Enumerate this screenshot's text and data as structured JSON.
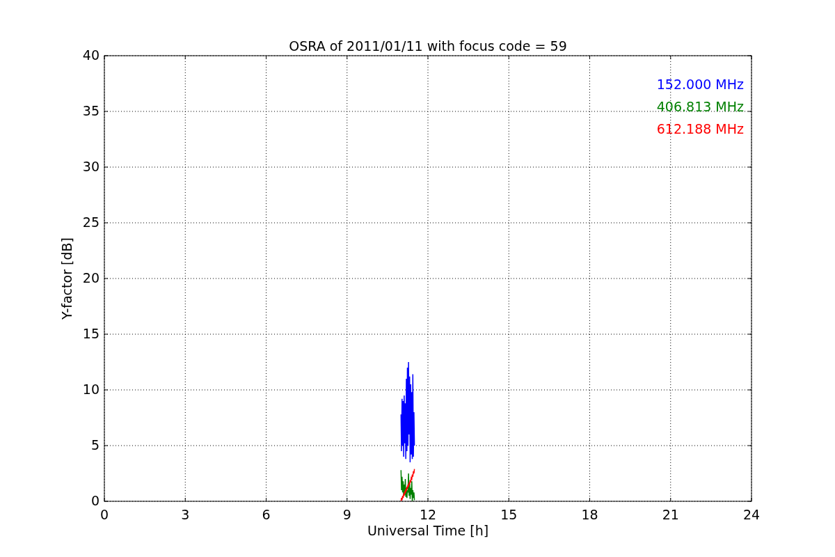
{
  "chart": {
    "chart_data": {
      "type": "line",
      "title": "OSRA of 2011/01/11 with focus code = 59",
      "xlabel": "Universal Time [h]",
      "ylabel": "Y-factor [dB]",
      "x": [
        11.0,
        11.02,
        11.04,
        11.06,
        11.08,
        11.1,
        11.12,
        11.14,
        11.16,
        11.18,
        11.2,
        11.22,
        11.24,
        11.26,
        11.28,
        11.3,
        11.32,
        11.34,
        11.36,
        11.38,
        11.4,
        11.42,
        11.44,
        11.46,
        11.48,
        11.5
      ],
      "series": [
        {
          "name": "152.000 MHz",
          "color": "#0000ff",
          "values": [
            7.8,
            4.5,
            9.2,
            5.0,
            9.0,
            4.0,
            9.5,
            5.2,
            8.8,
            3.8,
            11.0,
            4.5,
            12.0,
            5.0,
            12.5,
            6.0,
            11.2,
            3.5,
            10.5,
            4.2,
            9.8,
            3.8,
            11.4,
            4.0,
            8.0,
            5.0
          ]
        },
        {
          "name": "406.813 MHz",
          "color": "#008000",
          "values": [
            2.8,
            1.0,
            2.2,
            0.8,
            1.8,
            0.5,
            1.5,
            0.6,
            2.0,
            0.4,
            1.2,
            0.3,
            1.0,
            0.8,
            2.5,
            0.5,
            1.6,
            0.2,
            1.2,
            0.6,
            1.8,
            0.0,
            1.0,
            0.3,
            0.8,
            0.1
          ]
        },
        {
          "name": "612.188 MHz",
          "color": "#ff0000",
          "values": [
            0.0,
            0.3,
            0.1,
            0.5,
            0.3,
            0.7,
            0.5,
            0.9,
            0.7,
            1.1,
            0.9,
            1.3,
            1.1,
            1.5,
            1.3,
            1.7,
            1.5,
            1.9,
            1.7,
            2.1,
            2.0,
            2.4,
            2.2,
            2.7,
            2.5,
            2.9
          ]
        }
      ],
      "xlim": [
        0,
        24
      ],
      "ylim": [
        0,
        40
      ],
      "xticks": [
        0,
        3,
        6,
        9,
        12,
        15,
        18,
        21,
        24
      ],
      "yticks": [
        0,
        5,
        10,
        15,
        20,
        25,
        30,
        35,
        40
      ],
      "grid": true
    }
  }
}
